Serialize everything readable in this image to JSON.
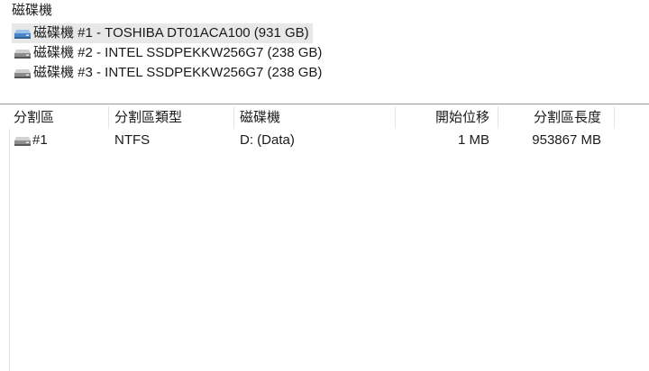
{
  "disks": {
    "title": "磁碟機",
    "items": [
      {
        "label": "磁碟機 #1 - TOSHIBA DT01ACA100 (931 GB)",
        "icon": "hard-disk-icon",
        "selected": true
      },
      {
        "label": "磁碟機 #2 - INTEL SSDPEKKW256G7 (238 GB)",
        "icon": "hard-disk-icon",
        "selected": false
      },
      {
        "label": "磁碟機 #3 - INTEL SSDPEKKW256G7 (238 GB)",
        "icon": "hard-disk-icon",
        "selected": false
      }
    ]
  },
  "partitions": {
    "columns": {
      "partition": "分割區",
      "type": "分割區類型",
      "drive": "磁碟機",
      "start": "開始位移",
      "length": "分割區長度"
    },
    "rows": [
      {
        "partition": "#1",
        "type": "NTFS",
        "drive": "D: (Data)",
        "start": "1 MB",
        "length": "953867 MB",
        "icon": "partition-icon"
      }
    ]
  },
  "colors": {
    "selection": "#e8e8e8",
    "disk_icon_blue": "#4a86c8",
    "disk_icon_gray": "#8a8a8a"
  }
}
